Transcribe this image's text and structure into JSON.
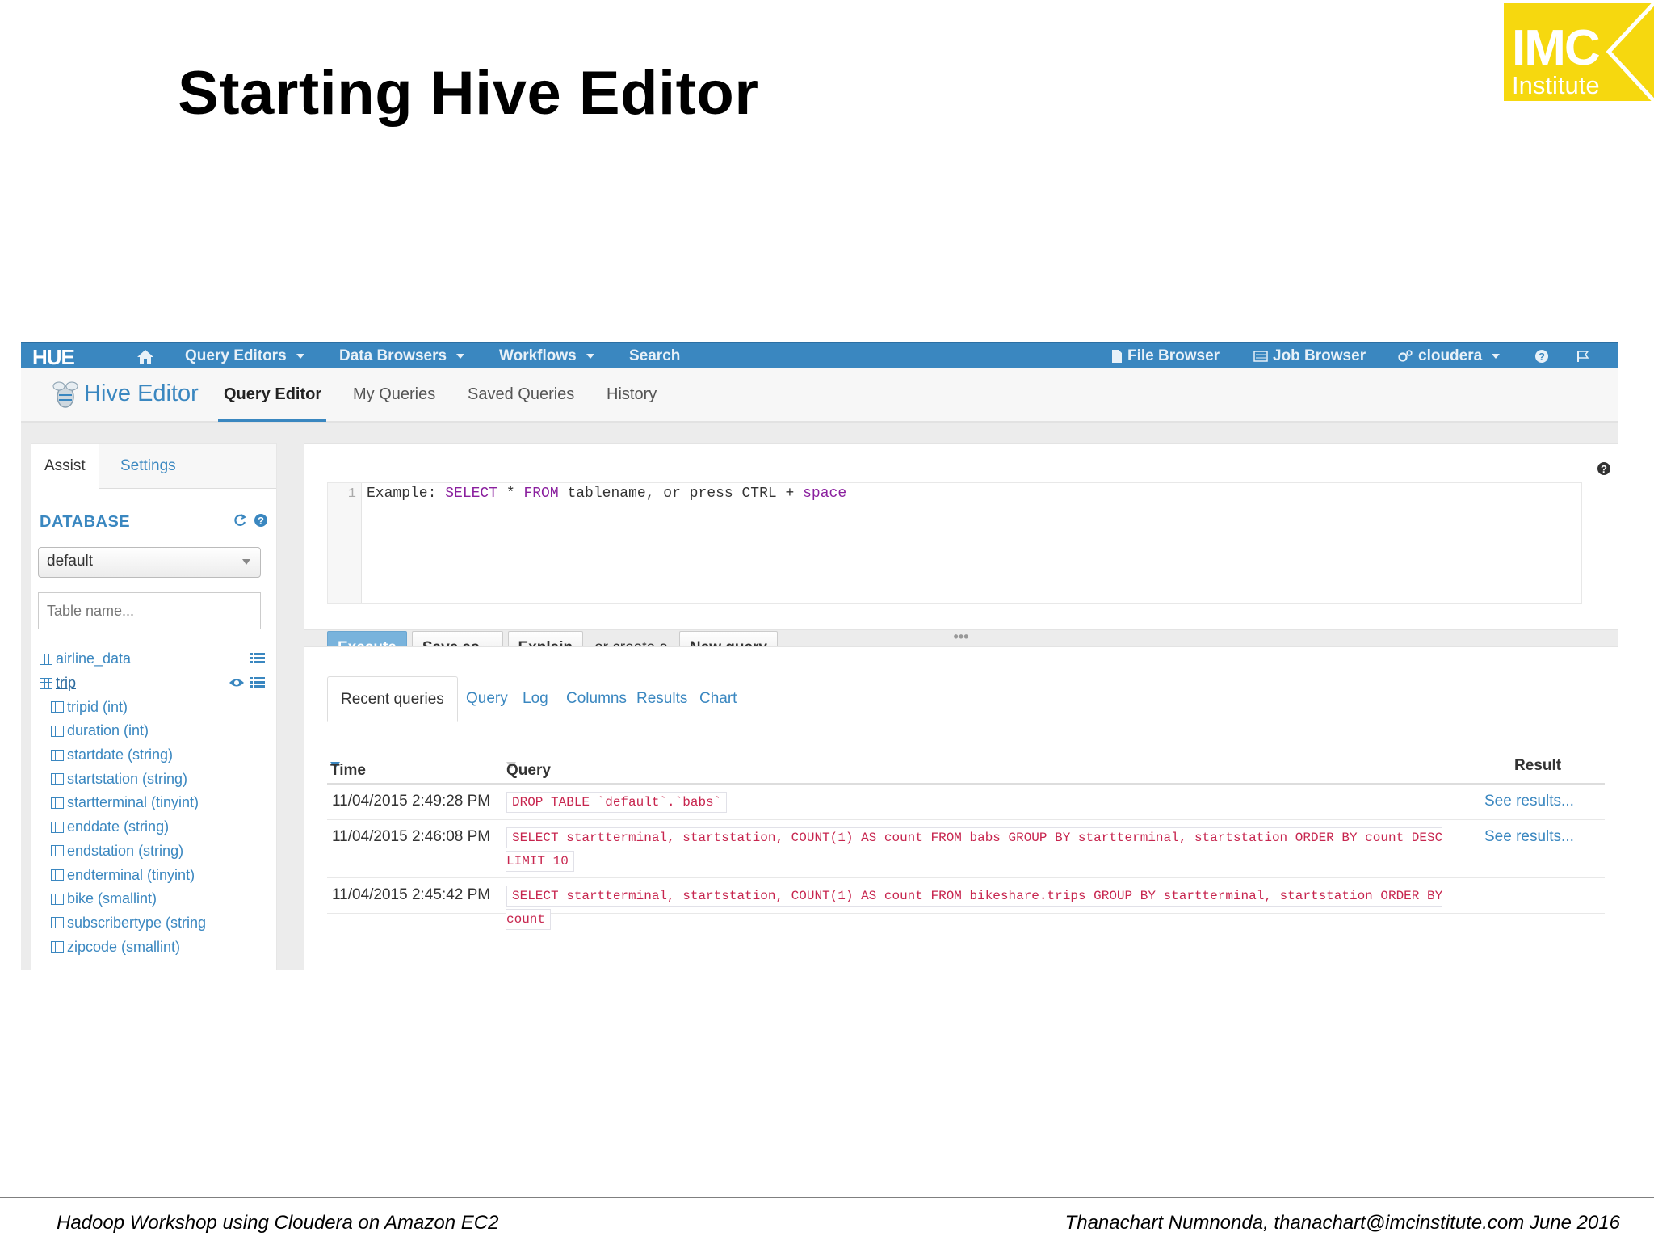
{
  "slide": {
    "title": "Starting Hive Editor",
    "logo_line1": "IMC",
    "logo_line2": "Institute",
    "footer_left": "Hadoop Workshop using Cloudera on Amazon EC2",
    "footer_right": "Thanachart Numnonda,  thanachart@imcinstitute.com  June 2016"
  },
  "navbar": {
    "logo": "HUE",
    "home_icon": "home-icon",
    "items": [
      "Query Editors",
      "Data Browsers",
      "Workflows",
      "Search"
    ],
    "right_items": [
      "File Browser",
      "Job Browser",
      "cloudera"
    ],
    "bg_color": "#3a87c0"
  },
  "subnav": {
    "app_name": "Hive Editor",
    "tabs": [
      "Query Editor",
      "My Queries",
      "Saved Queries",
      "History"
    ],
    "active_tab": "Query Editor"
  },
  "assist": {
    "tabs": [
      "Assist",
      "Settings"
    ],
    "database_label": "DATABASE",
    "database_selected": "default",
    "table_filter_placeholder": "Table name...",
    "tables": [
      "airline_data",
      "trip"
    ],
    "columns": [
      "tripid (int)",
      "duration (int)",
      "startdate (string)",
      "startstation (string)",
      "startterminal (tinyint)",
      "enddate (string)",
      "endstation (string)",
      "endterminal (tinyint)",
      "bike (smallint)",
      "subscribertype (string",
      "zipcode (smallint)"
    ]
  },
  "editor": {
    "line_number": "1",
    "placeholder_parts": [
      "Example: ",
      "SELECT",
      " * ",
      "FROM",
      " tablename, or press CTRL + ",
      "space"
    ],
    "buttons": {
      "execute": "Execute",
      "save_as": "Save as...",
      "explain": "Explain",
      "or_create": "or create a",
      "new_query": "New query"
    }
  },
  "results": {
    "tabs": [
      "Recent queries",
      "Query",
      "Log",
      "Columns",
      "Results",
      "Chart"
    ],
    "headers": {
      "time": "Time",
      "query": "Query",
      "result": "Result"
    },
    "rows": [
      {
        "time": "11/04/2015 2:49:28 PM",
        "query": "DROP TABLE `default`.`babs`",
        "result": "See results..."
      },
      {
        "time": "11/04/2015 2:46:08 PM",
        "query": "SELECT startterminal, startstation, COUNT(1) AS count FROM babs GROUP BY startterminal, startstation ORDER BY count DESC LIMIT 10",
        "result": "See results..."
      },
      {
        "time": "11/04/2015 2:45:42 PM",
        "query": "SELECT startterminal, startstation, COUNT(1) AS count FROM bikeshare.trips GROUP BY startterminal, startstation ORDER BY count",
        "result": ""
      }
    ]
  }
}
